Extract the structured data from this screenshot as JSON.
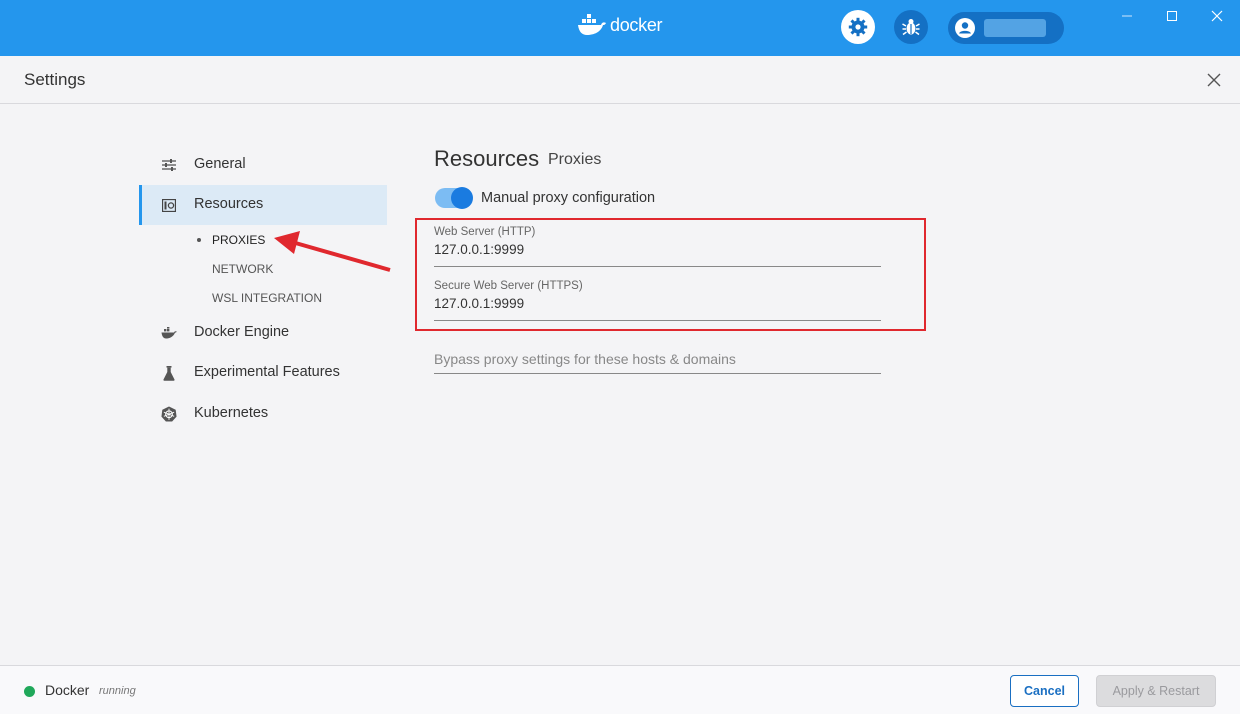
{
  "titlebar": {
    "brand": "docker",
    "colors": {
      "bar": "#2496ed",
      "button": "#1470c4"
    },
    "icons": [
      "docker-whale-icon",
      "gear-icon",
      "bug-icon",
      "account-icon",
      "minimize-icon",
      "maximize-icon",
      "close-icon"
    ]
  },
  "header": {
    "title": "Settings"
  },
  "sidebar": {
    "items": [
      {
        "label": "General",
        "icon": "sliders-icon"
      },
      {
        "label": "Resources",
        "icon": "resources-icon",
        "active": true
      },
      {
        "label": "Docker Engine",
        "icon": "whale-icon"
      },
      {
        "label": "Experimental Features",
        "icon": "flask-icon"
      },
      {
        "label": "Kubernetes",
        "icon": "kubernetes-icon"
      }
    ],
    "subitems": [
      {
        "label": "PROXIES",
        "active": true
      },
      {
        "label": "NETWORK"
      },
      {
        "label": "WSL INTEGRATION"
      }
    ]
  },
  "content": {
    "title": "Resources",
    "subtitle": "Proxies",
    "toggle_label": "Manual proxy configuration",
    "toggle_on": true,
    "fields": [
      {
        "label": "Web Server (HTTP)",
        "value": "127.0.0.1:9999"
      },
      {
        "label": "Secure Web Server (HTTPS)",
        "value": "127.0.0.1:9999"
      }
    ],
    "bypass_placeholder": "Bypass proxy settings for these hosts & domains"
  },
  "footer": {
    "app_name": "Docker",
    "status": "running",
    "status_color": "#20a85a",
    "cancel_label": "Cancel",
    "apply_label": "Apply & Restart"
  }
}
